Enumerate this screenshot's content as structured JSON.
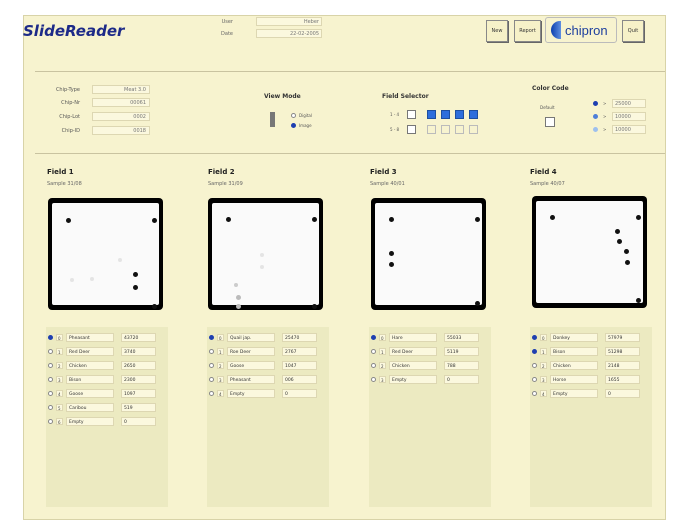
{
  "app": {
    "title": "SlideReader",
    "user_label": "User",
    "user_value": "Heber",
    "date_label": "Date",
    "date_value": "22-02-2005",
    "logo_text": "chipron"
  },
  "toolbar": {
    "new_label": "New",
    "report_label": "Report",
    "quit_label": "Quit"
  },
  "chip_info": [
    {
      "label": "Chip-Type",
      "value": "Meat 3.0"
    },
    {
      "label": "Chip-Nr",
      "value": "00061"
    },
    {
      "label": "Chip-Lot",
      "value": "0002"
    },
    {
      "label": "Chip-ID",
      "value": "0018"
    }
  ],
  "view_mode": {
    "title": "View Mode",
    "options": [
      {
        "label": "Digital",
        "selected": false
      },
      {
        "label": "Image",
        "selected": true
      }
    ]
  },
  "field_selector": {
    "title": "Field Selector",
    "rows": [
      {
        "label": "1 - 4",
        "fields": [
          true,
          true,
          true,
          true
        ]
      },
      {
        "label": "5 - 8",
        "fields": [
          false,
          false,
          false,
          false
        ]
      }
    ]
  },
  "color_code": {
    "title": "Color Code",
    "default_label": "Default",
    "levels": [
      {
        "op": ">",
        "value": "25000",
        "color": "#1e3fb0"
      },
      {
        "op": ">",
        "value": "10000",
        "color": "#4f7fd8"
      },
      {
        "op": ">",
        "value": "10000",
        "color": "#9ec0ee"
      }
    ]
  },
  "fields": [
    {
      "title": "Field 1",
      "sample": "Sample 31/08",
      "rows": [
        {
          "num": "0",
          "name": "Pheasant",
          "value": "43720",
          "selected": true
        },
        {
          "num": "1",
          "name": "Red Deer",
          "value": "3740",
          "selected": false
        },
        {
          "num": "2",
          "name": "Chicken",
          "value": "2650",
          "selected": false
        },
        {
          "num": "3",
          "name": "Bison",
          "value": "2300",
          "selected": false
        },
        {
          "num": "4",
          "name": "Goose",
          "value": "1097",
          "selected": false
        },
        {
          "num": "5",
          "name": "Caribou",
          "value": "519",
          "selected": false
        },
        {
          "num": "6",
          "name": "Empty",
          "value": "0",
          "selected": false
        }
      ]
    },
    {
      "title": "Field 2",
      "sample": "Sample 31/09",
      "rows": [
        {
          "num": "0",
          "name": "Quail jap.",
          "value": "25470",
          "selected": true
        },
        {
          "num": "1",
          "name": "Roe Deer",
          "value": "2767",
          "selected": false
        },
        {
          "num": "2",
          "name": "Goose",
          "value": "1047",
          "selected": false
        },
        {
          "num": "3",
          "name": "Pheasant",
          "value": "006",
          "selected": false
        },
        {
          "num": "4",
          "name": "Empty",
          "value": "0",
          "selected": false
        }
      ]
    },
    {
      "title": "Field 3",
      "sample": "Sample 40/01",
      "rows": [
        {
          "num": "0",
          "name": "Hare",
          "value": "55033",
          "selected": true
        },
        {
          "num": "1",
          "name": "Red Deer",
          "value": "5119",
          "selected": false
        },
        {
          "num": "2",
          "name": "Chicken",
          "value": "788",
          "selected": false
        },
        {
          "num": "3",
          "name": "Empty",
          "value": "0",
          "selected": false
        }
      ]
    },
    {
      "title": "Field 4",
      "sample": "Sample 40/07",
      "rows": [
        {
          "num": "0",
          "name": "Donkey",
          "value": "57979",
          "selected": true
        },
        {
          "num": "1",
          "name": "Bison",
          "value": "51298",
          "selected": true
        },
        {
          "num": "2",
          "name": "Chicken",
          "value": "2148",
          "selected": false
        },
        {
          "num": "3",
          "name": "Horse",
          "value": "1655",
          "selected": false
        },
        {
          "num": "4",
          "name": "Empty",
          "value": "0",
          "selected": false
        }
      ]
    }
  ]
}
